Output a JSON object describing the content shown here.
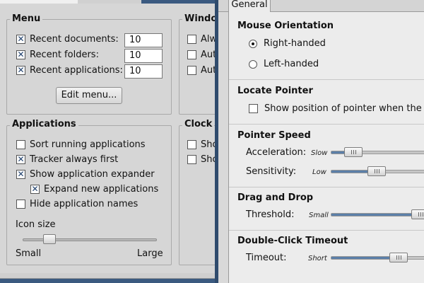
{
  "left": {
    "menu": {
      "title": "Menu",
      "items": [
        {
          "label": "Recent documents:",
          "value": "10",
          "checked": true
        },
        {
          "label": "Recent folders:",
          "value": "10",
          "checked": true
        },
        {
          "label": "Recent applications:",
          "value": "10",
          "checked": true
        }
      ],
      "edit_button": "Edit menu..."
    },
    "windows": {
      "title": "Windo",
      "items": [
        {
          "label": "Alw",
          "checked": false
        },
        {
          "label": "Aut",
          "checked": false
        },
        {
          "label": "Aut",
          "checked": false
        }
      ]
    },
    "applications": {
      "title": "Applications",
      "items": [
        {
          "label": "Sort running applications",
          "checked": false
        },
        {
          "label": "Tracker always first",
          "checked": true
        },
        {
          "label": "Show application expander",
          "checked": true
        },
        {
          "label": "Expand new applications",
          "checked": true
        },
        {
          "label": "Hide application names",
          "checked": false
        }
      ],
      "icon_size": {
        "label": "Icon size",
        "min_label": "Small",
        "max_label": "Large",
        "value_fraction": 0.2
      }
    },
    "clock": {
      "title": "Clock",
      "items": [
        {
          "label": "Sho",
          "checked": false
        },
        {
          "label": "Sho",
          "checked": false
        }
      ]
    }
  },
  "right": {
    "tab": "General",
    "mouse_orientation": {
      "title": "Mouse Orientation",
      "options": [
        {
          "label": "Right-handed",
          "selected": true
        },
        {
          "label": "Left-handed",
          "selected": false
        }
      ]
    },
    "locate_pointer": {
      "title": "Locate Pointer",
      "option": {
        "label": "Show position of pointer when the Cont",
        "checked": false
      }
    },
    "pointer_speed": {
      "title": "Pointer Speed",
      "acceleration": {
        "label": "Acceleration:",
        "scale": "Slow",
        "value_fraction": 0.25
      },
      "sensitivity": {
        "label": "Sensitivity:",
        "scale": "Low",
        "value_fraction": 0.45
      }
    },
    "drag_and_drop": {
      "title": "Drag and Drop",
      "threshold": {
        "label": "Threshold:",
        "scale": "Small",
        "value_fraction": 0.95
      }
    },
    "double_click": {
      "title": "Double-Click Timeout",
      "timeout": {
        "label": "Timeout:",
        "scale": "Short",
        "value_fraction": 0.7
      }
    }
  },
  "colors": {
    "accent": "#5b7fa8",
    "titlebar": "#3b5a80",
    "check": "#1e3f6c"
  }
}
